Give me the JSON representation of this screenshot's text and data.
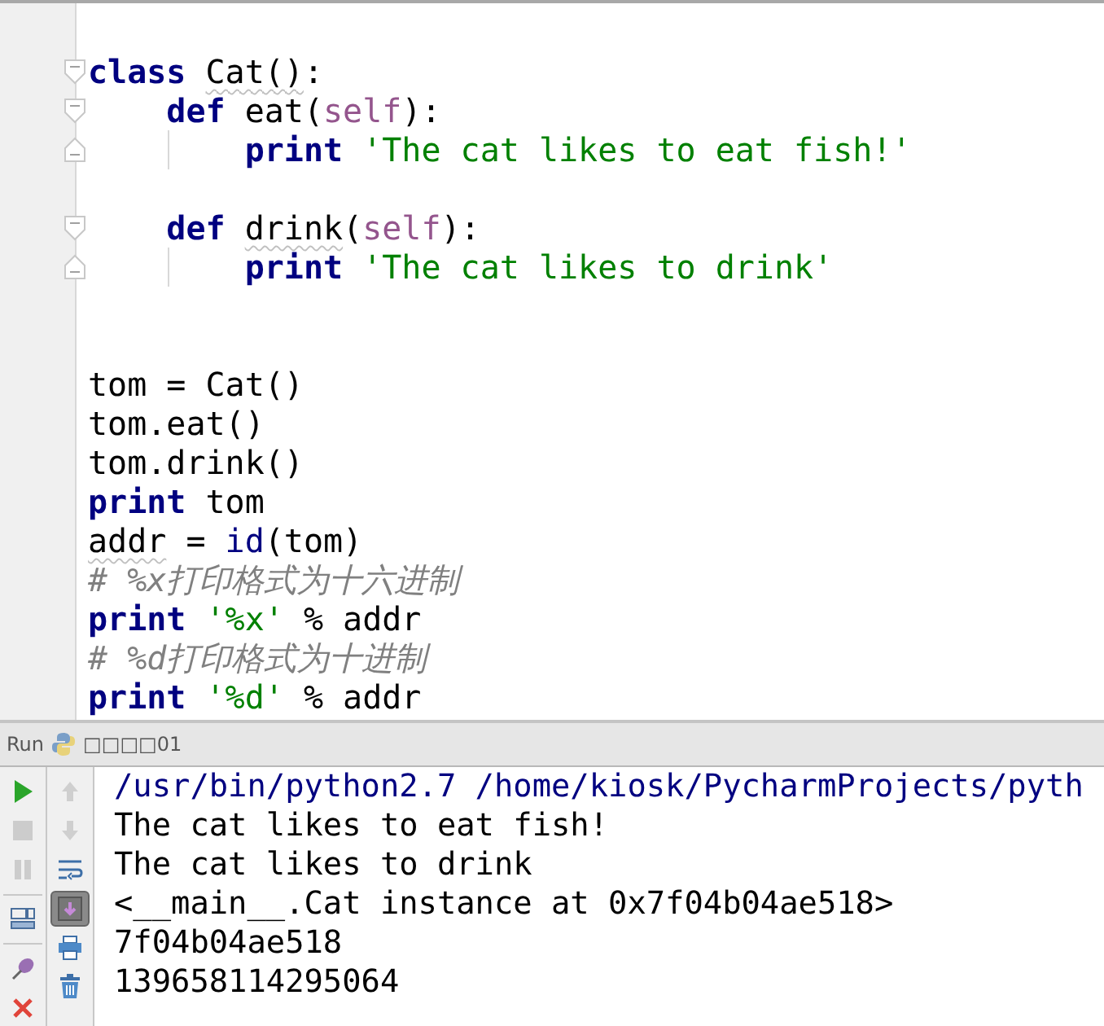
{
  "editor": {
    "lines": [
      {
        "kind": "blank"
      },
      {
        "kind": "code",
        "fold_open": true,
        "tokens": [
          {
            "text": "class ",
            "kind": "keyword"
          },
          {
            "text": "Cat()",
            "kind": "plain",
            "warning": true
          },
          {
            "text": ":",
            "kind": "plain"
          }
        ]
      },
      {
        "kind": "code",
        "fold_open": true,
        "tokens": [
          {
            "text": "    def",
            "kind": "keyword"
          },
          {
            "text": " eat(",
            "kind": "plain"
          },
          {
            "text": "self",
            "kind": "self"
          },
          {
            "text": "):",
            "kind": "plain"
          }
        ]
      },
      {
        "kind": "code",
        "fold_close": true,
        "indent_guide": true,
        "tokens": [
          {
            "text": "        print ",
            "kind": "keyword"
          },
          {
            "text": "'The cat likes to eat fish!'",
            "kind": "string"
          }
        ]
      },
      {
        "kind": "blank"
      },
      {
        "kind": "code",
        "fold_open": true,
        "tokens": [
          {
            "text": "    def ",
            "kind": "keyword"
          },
          {
            "text": "drink",
            "kind": "plain",
            "warning": true
          },
          {
            "text": "(",
            "kind": "plain"
          },
          {
            "text": "self",
            "kind": "self"
          },
          {
            "text": "):",
            "kind": "plain"
          }
        ]
      },
      {
        "kind": "code",
        "fold_close": true,
        "indent_guide": true,
        "tokens": [
          {
            "text": "        print ",
            "kind": "keyword"
          },
          {
            "text": "'The cat likes to drink'",
            "kind": "string"
          }
        ]
      },
      {
        "kind": "blank"
      },
      {
        "kind": "blank"
      },
      {
        "kind": "code",
        "tokens": [
          {
            "text": "tom = Cat()",
            "kind": "plain"
          }
        ]
      },
      {
        "kind": "code",
        "tokens": [
          {
            "text": "tom.eat()",
            "kind": "plain"
          }
        ]
      },
      {
        "kind": "code",
        "tokens": [
          {
            "text": "tom.drink()",
            "kind": "plain"
          }
        ]
      },
      {
        "kind": "code",
        "tokens": [
          {
            "text": "print",
            "kind": "keyword"
          },
          {
            "text": " tom",
            "kind": "plain"
          }
        ]
      },
      {
        "kind": "code",
        "tokens": [
          {
            "text": "addr",
            "kind": "plain",
            "warning": true
          },
          {
            "text": " = ",
            "kind": "plain"
          },
          {
            "text": "id",
            "kind": "builtin"
          },
          {
            "text": "(tom)",
            "kind": "plain"
          }
        ]
      },
      {
        "kind": "code",
        "tokens": [
          {
            "text": "# %x打印格式为十六进制",
            "kind": "comment"
          }
        ]
      },
      {
        "kind": "code",
        "tokens": [
          {
            "text": "print ",
            "kind": "keyword"
          },
          {
            "text": "'%x'",
            "kind": "string"
          },
          {
            "text": " % addr",
            "kind": "plain"
          }
        ]
      },
      {
        "kind": "code",
        "tokens": [
          {
            "text": "# %d打印格式为十进制",
            "kind": "comment"
          }
        ]
      },
      {
        "kind": "code",
        "tokens": [
          {
            "text": "print ",
            "kind": "keyword"
          },
          {
            "text": "'%d'",
            "kind": "string"
          },
          {
            "text": " % addr",
            "kind": "plain"
          }
        ]
      }
    ]
  },
  "run_bar": {
    "label": "Run",
    "config_name": "□□□□01"
  },
  "toolbar_left": [
    {
      "kind": "run",
      "disabled": false
    },
    {
      "kind": "stop",
      "disabled": true
    },
    {
      "kind": "pause",
      "disabled": true
    },
    {
      "kind": "layout",
      "disabled": false
    },
    {
      "kind": "pin",
      "disabled": false
    },
    {
      "kind": "close",
      "disabled": false
    }
  ],
  "toolbar_right": [
    {
      "kind": "up",
      "disabled": true,
      "selected": false
    },
    {
      "kind": "down",
      "disabled": true,
      "selected": false
    },
    {
      "kind": "wrap",
      "disabled": false,
      "selected": false
    },
    {
      "kind": "scroll-end",
      "disabled": false,
      "selected": true
    },
    {
      "kind": "print",
      "disabled": false,
      "selected": false
    },
    {
      "kind": "trash",
      "disabled": false,
      "selected": false
    }
  ],
  "console": [
    {
      "kind": "command",
      "text": "/usr/bin/python2.7 /home/kiosk/PycharmProjects/pyth"
    },
    {
      "kind": "output",
      "text": "The cat likes to eat fish!"
    },
    {
      "kind": "output",
      "text": "The cat likes to drink"
    },
    {
      "kind": "output",
      "text": "<__main__.Cat instance at 0x7f04b04ae518>"
    },
    {
      "kind": "output",
      "text": "7f04b04ae518"
    },
    {
      "kind": "output",
      "text": "139658114295064"
    }
  ]
}
